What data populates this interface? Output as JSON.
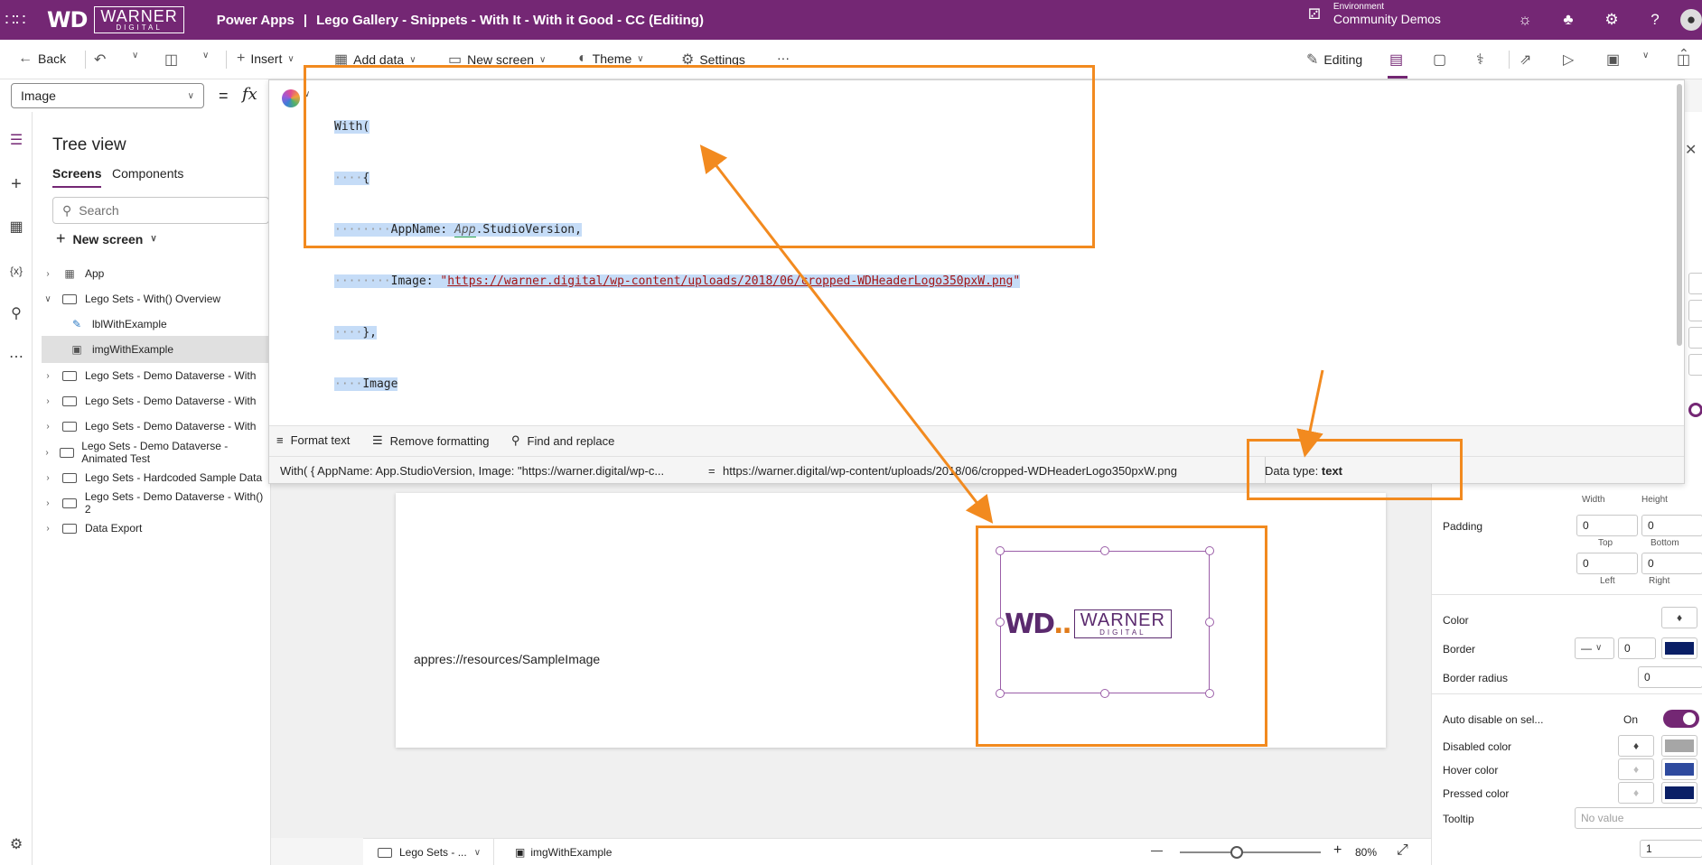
{
  "topbar": {
    "logo_wd": "WD",
    "logo_word": "WARNER",
    "logo_sub": "DIGITAL",
    "app_name": "Power Apps",
    "separator": "|",
    "title": "Lego Gallery - Snippets - With It - With it Good - CC (Editing)",
    "env_label": "Environment",
    "env_value": "Community Demos"
  },
  "commandbar": {
    "back": "Back",
    "insert": "Insert",
    "add_data": "Add data",
    "new_screen": "New screen",
    "theme": "Theme",
    "settings": "Settings",
    "more": "···",
    "editing": "Editing"
  },
  "formula_bar": {
    "property": "Image",
    "equals": "=",
    "fx": "fx"
  },
  "editor": {
    "line1": "With(",
    "line2": "{",
    "line3_key": "AppName: ",
    "line3_ref": "App",
    "line3_rest": ".StudioVersion,",
    "line4_key": "Image: ",
    "line4_q1": "\"",
    "line4_url": "https://warner.digital/wp-content/uploads/2018/06/cropped-WDHeaderLogo350pxW.png",
    "line4_q2": "\"",
    "line5": "},",
    "line6": "Image",
    "line7": ")",
    "format_text": "Format text",
    "remove_formatting": "Remove formatting",
    "find_replace": "Find and replace",
    "result_expr": "With( { AppName: App.StudioVersion, Image: \"https://warner.digital/wp-c...",
    "result_eq": "=",
    "result_value": "https://warner.digital/wp-content/uploads/2018/06/cropped-WDHeaderLogo350pxW.png",
    "data_type_label": "Data type:",
    "data_type_value": "text"
  },
  "tree": {
    "title": "Tree view",
    "tab_screens": "Screens",
    "tab_components": "Components",
    "search_placeholder": "Search",
    "new_screen": "New screen",
    "items": [
      {
        "label": "App"
      },
      {
        "label": "Lego Sets - With() Overview"
      },
      {
        "label": "lblWithExample"
      },
      {
        "label": "imgWithExample"
      },
      {
        "label": "Lego Sets - Demo Dataverse - With"
      },
      {
        "label": "Lego Sets - Demo Dataverse - With"
      },
      {
        "label": "Lego Sets - Demo Dataverse - With"
      },
      {
        "label": "Lego Sets - Demo Dataverse - Animated Test"
      },
      {
        "label": "Lego Sets - Hardcoded Sample Data"
      },
      {
        "label": "Lego Sets - Demo Dataverse - With() 2"
      },
      {
        "label": "Data Export"
      }
    ]
  },
  "canvas": {
    "label_text": "appres://resources/SampleImage",
    "image_logo_wd": "WD",
    "image_logo_dot": "..",
    "image_logo_word": "WARNER",
    "image_logo_sub": "DIGITAL",
    "status_screen": "Lego Sets - ...",
    "status_control": "imgWithExample",
    "zoom": "80%",
    "zoom_minus": "—",
    "zoom_plus": "+"
  },
  "properties": {
    "width_label": "Width",
    "height_label": "Height",
    "padding": "Padding",
    "padding_top": "0",
    "padding_bottom": "0",
    "padding_left": "0",
    "padding_right": "0",
    "top_label": "Top",
    "bottom_label": "Bottom",
    "left_label": "Left",
    "right_label": "Right",
    "color": "Color",
    "border": "Border",
    "border_style": "—",
    "border_width": "0",
    "border_radius": "Border radius",
    "border_radius_value": "0",
    "auto_disable": "Auto disable on sel...",
    "auto_disable_state": "On",
    "disabled_color": "Disabled color",
    "hover_color": "Hover color",
    "pressed_color": "Pressed color",
    "tooltip": "Tooltip",
    "tooltip_placeholder": "No value",
    "tooltip_value": "1",
    "colors": {
      "border": "#0a1f66",
      "disabled": "#a6a6a6",
      "hover": "#2e4a9e",
      "pressed": "#0a1f66"
    }
  },
  "accent_colors": {
    "brand": "#742774",
    "annotation": "#f28a1f",
    "selection": "#c5dcf7"
  }
}
